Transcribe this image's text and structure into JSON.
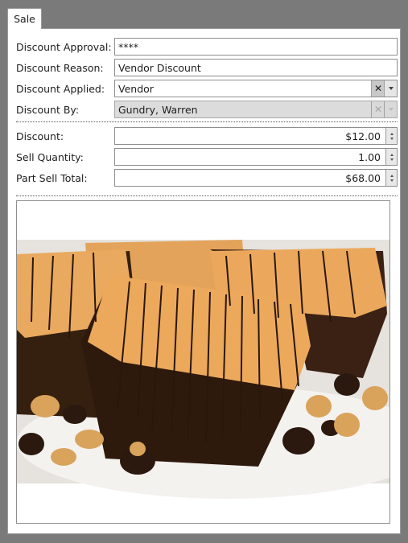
{
  "tab": {
    "label": "Sale"
  },
  "form": {
    "approval": {
      "label": "Discount Approval:",
      "value": "****"
    },
    "reason": {
      "label": "Discount Reason:",
      "value": "Vendor Discount"
    },
    "applied": {
      "label": "Discount Applied:",
      "value": "Vendor"
    },
    "by": {
      "label": "Discount By:",
      "value": "Gundry, Warren"
    },
    "discount": {
      "label": "Discount:",
      "value": "$12.00"
    },
    "quantity": {
      "label": "Sell Quantity:",
      "value": "1.00"
    },
    "total": {
      "label": "Part Sell Total:",
      "value": "$68.00"
    }
  },
  "icons": {
    "clear": "close-icon",
    "dropdown": "chevron-down-icon",
    "spinner": "spinner-arrows-icon"
  },
  "colors": {
    "background": "#7a7a7a",
    "panel": "#ffffff",
    "disabled_field": "#dcdcdc"
  }
}
